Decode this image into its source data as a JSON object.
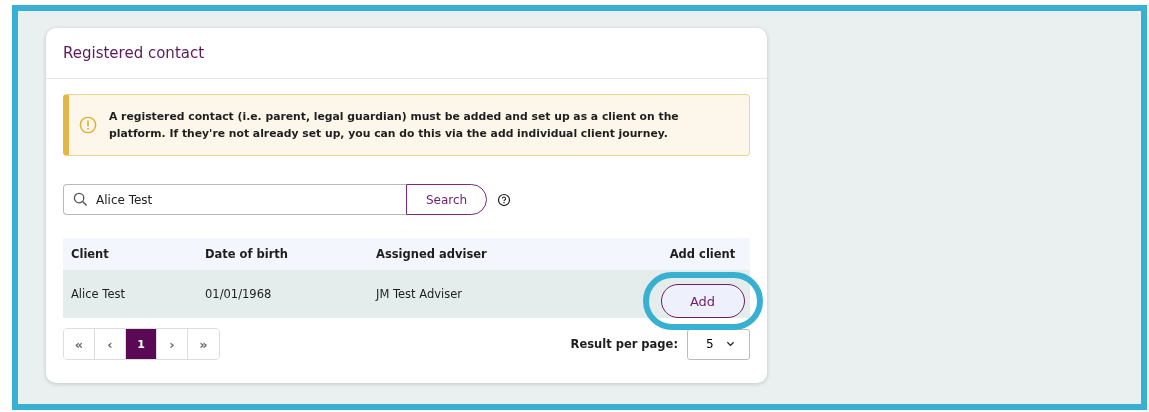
{
  "card": {
    "title": "Registered contact"
  },
  "alert": {
    "text": "A registered contact (i.e. parent, legal guardian) must be added and set up as a client on the platform. If they're not already set up, you can do this via the add individual client journey."
  },
  "search": {
    "value": "Alice Test",
    "button": "Search"
  },
  "table": {
    "columns": [
      "Client",
      "Date of birth",
      "Assigned adviser",
      "Add client"
    ],
    "rows": [
      {
        "client": "Alice Test",
        "date_of_birth": "01/01/1968",
        "adviser": "JM Test Adviser",
        "action": "Add",
        "highlighted": true
      }
    ]
  },
  "pagination": {
    "first": "«",
    "previous": "‹",
    "pages": [
      {
        "label": "1",
        "selected": true
      }
    ],
    "next": "›",
    "last": "»"
  },
  "page_size": {
    "label": "Result per page:",
    "value": "5"
  }
}
